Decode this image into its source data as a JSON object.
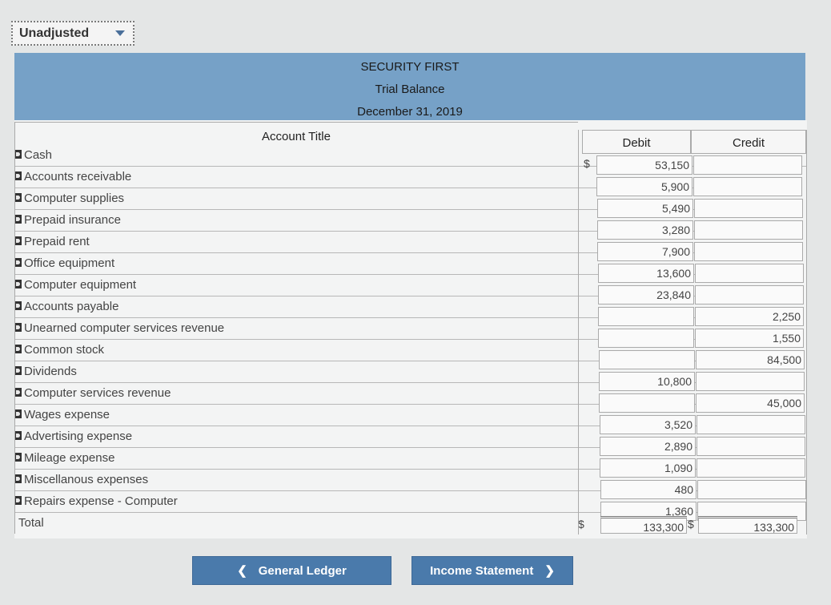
{
  "dropdown": {
    "value": "Unadjusted"
  },
  "header": {
    "company": "SECURITY FIRST",
    "statement": "Trial Balance",
    "date": "December 31, 2019"
  },
  "columns": {
    "account_title": "Account Title",
    "debit": "Debit",
    "credit": "Credit"
  },
  "currency_symbol": "$",
  "rows": [
    {
      "account": "Cash",
      "debit": "53,150",
      "credit": ""
    },
    {
      "account": "Accounts receivable",
      "debit": "5,900",
      "credit": ""
    },
    {
      "account": "Computer supplies",
      "debit": "5,490",
      "credit": ""
    },
    {
      "account": "Prepaid insurance",
      "debit": "3,280",
      "credit": ""
    },
    {
      "account": "Prepaid rent",
      "debit": "7,900",
      "credit": ""
    },
    {
      "account": "Office equipment",
      "debit": "13,600",
      "credit": ""
    },
    {
      "account": "Computer equipment",
      "debit": "23,840",
      "credit": ""
    },
    {
      "account": "Accounts payable",
      "debit": "",
      "credit": "2,250"
    },
    {
      "account": "Unearned computer services revenue",
      "debit": "",
      "credit": "1,550"
    },
    {
      "account": "Common stock",
      "debit": "",
      "credit": "84,500"
    },
    {
      "account": "Dividends",
      "debit": "10,800",
      "credit": ""
    },
    {
      "account": "Computer services revenue",
      "debit": "",
      "credit": "45,000"
    },
    {
      "account": "Wages expense",
      "debit": "3,520",
      "credit": ""
    },
    {
      "account": "Advertising expense",
      "debit": "2,890",
      "credit": ""
    },
    {
      "account": "Mileage expense",
      "debit": "1,090",
      "credit": ""
    },
    {
      "account": "Miscellanous expenses",
      "debit": "480",
      "credit": ""
    },
    {
      "account": "Repairs expense - Computer",
      "debit": "1,360",
      "credit": ""
    }
  ],
  "total": {
    "label": "Total",
    "debit": "133,300",
    "credit": "133,300"
  },
  "buttons": {
    "prev": "General Ledger",
    "next": "Income Statement"
  },
  "icons": {
    "prev": "chevron-left-icon",
    "next": "chevron-right-icon",
    "dropdown": "caret-down-icon",
    "row": "flag-icon"
  }
}
